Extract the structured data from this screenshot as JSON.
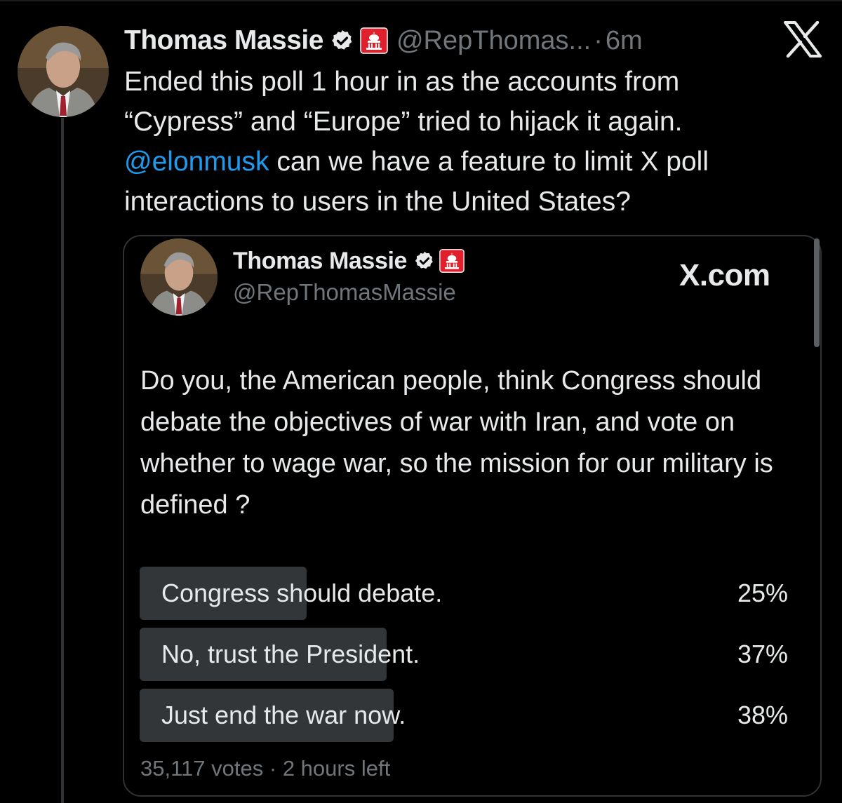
{
  "tweet": {
    "author_name": "Thomas Massie",
    "handle": "@RepThomas...",
    "separator": "·",
    "time": "6m",
    "text_line1": "Ended this poll 1 hour in as the accounts from",
    "text_line2": "“Cypress” and “Europe” tried to hijack it again.",
    "mention": "@elonmusk",
    "text_line3_rest": " can we have a feature to limit X poll",
    "text_line4": "interactions to users in the United States?"
  },
  "quote": {
    "author_name": "Thomas Massie",
    "handle": "@RepThomasMassie",
    "source": "X.com",
    "question": "Do you, the American people, think Congress should debate the objectives of war with Iran, and vote on whether to wage war, so the mission for our military is defined ?",
    "poll": {
      "options": [
        {
          "label": "Congress should debate.",
          "percent_text": "25%",
          "percent": 25
        },
        {
          "label": "No, trust the President.",
          "percent_text": "37%",
          "percent": 37
        },
        {
          "label": "Just end the war now.",
          "percent_text": "38%",
          "percent": 38
        }
      ],
      "votes": "35,117 votes",
      "separator": "·",
      "time_left": "2 hours left"
    }
  },
  "icons": {
    "verified": "verified-badge-icon",
    "affiliate": "gop-badge-icon",
    "x": "x-logo-icon"
  },
  "colors": {
    "background": "#000000",
    "text": "#e7e9ea",
    "muted": "#71767b",
    "link": "#1d9bf0",
    "poll_bar": "#333639",
    "border": "#2f3336",
    "affiliate_red": "#e0202c"
  }
}
